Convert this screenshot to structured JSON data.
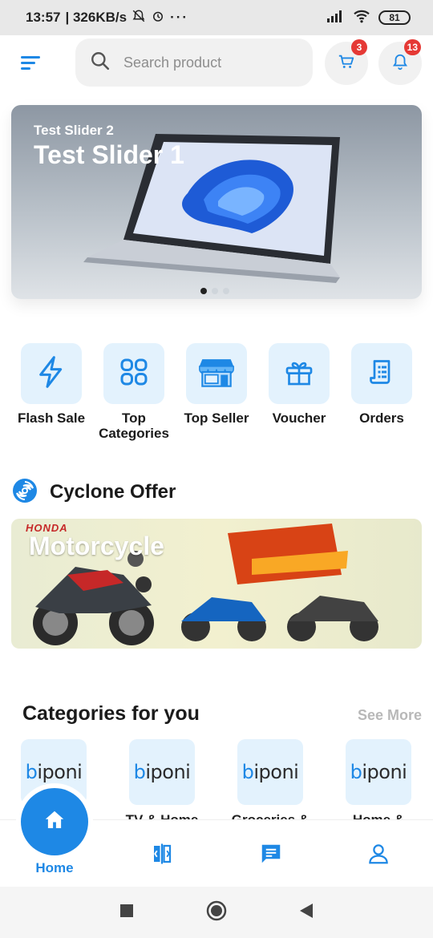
{
  "status_bar": {
    "time": "13:57",
    "speed": "| 326KB/s",
    "battery": "81"
  },
  "header": {
    "search_placeholder": "Search product",
    "cart_badge": "3",
    "notification_badge": "13"
  },
  "slider": {
    "subtitle": "Test Slider 2",
    "title": "Test Slider 1"
  },
  "quick_actions": [
    {
      "label": "Flash Sale",
      "icon": "lightning-icon"
    },
    {
      "label": "Top Categories",
      "icon": "grid-icon"
    },
    {
      "label": "Top Seller",
      "icon": "store-icon"
    },
    {
      "label": "Voucher",
      "icon": "gift-icon"
    },
    {
      "label": "Orders",
      "icon": "receipt-icon"
    }
  ],
  "offer_section": {
    "title": "Cyclone Offer",
    "banner_brand": "HONDA",
    "banner_title": "Motorcycle"
  },
  "categories": {
    "title": "Categories for you",
    "see_more": "See More",
    "items": [
      {
        "logo_b": "b",
        "logo_rest": "iponi",
        "name": ""
      },
      {
        "logo_b": "b",
        "logo_rest": "iponi",
        "name": "TV & Home"
      },
      {
        "logo_b": "b",
        "logo_rest": "iponi",
        "name": "Groceries &"
      },
      {
        "logo_b": "b",
        "logo_rest": "iponi",
        "name": "Home &"
      }
    ]
  },
  "bottom_nav": {
    "home_label": "Home"
  },
  "colors": {
    "accent": "#1e88e5",
    "tile_bg": "#e3f2fd",
    "badge": "#e53935"
  }
}
